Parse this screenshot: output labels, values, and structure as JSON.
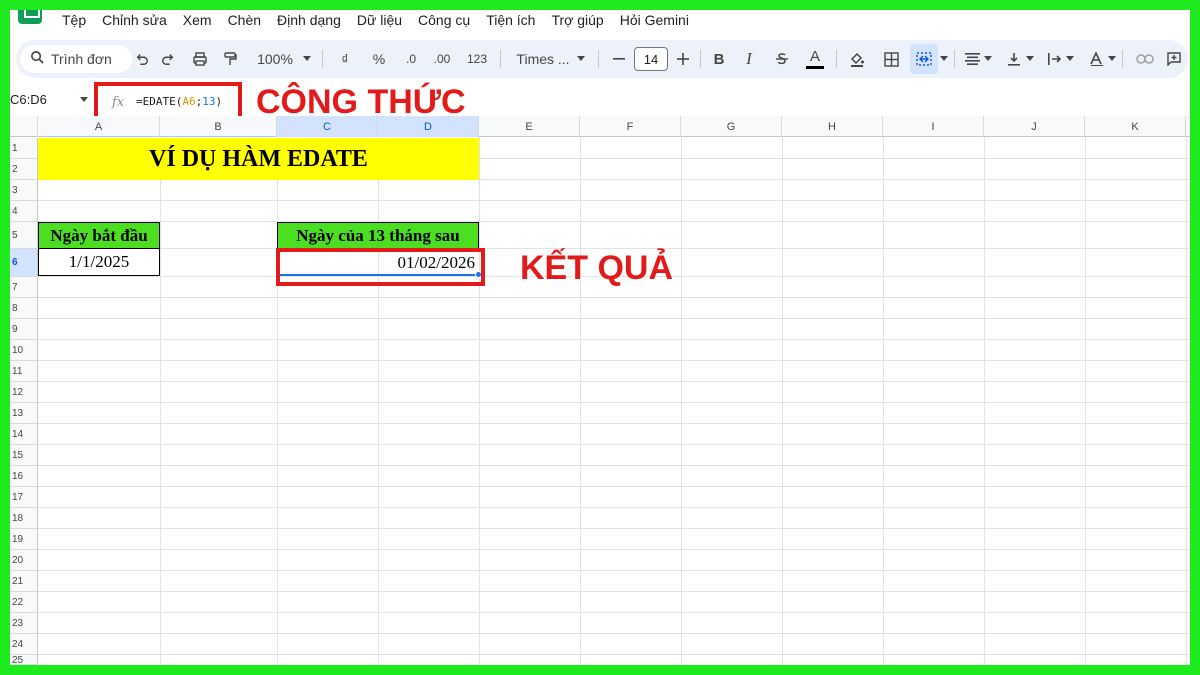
{
  "menu": {
    "items": [
      "Tệp",
      "Chỉnh sửa",
      "Xem",
      "Chèn",
      "Định dạng",
      "Dữ liệu",
      "Công cụ",
      "Tiện ích",
      "Trợ giúp",
      "Hỏi Gemini"
    ]
  },
  "toolbar": {
    "search_label": "Trình đơn",
    "zoom": "100%",
    "currency": "₫",
    "percent": "%",
    "decimal_decrease": ".0",
    "decimal_increase": ".00",
    "number_format": "123",
    "font_name": "Times ...",
    "font_size": "14",
    "bold": "B",
    "italic": "I",
    "text_color": "A"
  },
  "formula_bar": {
    "name_box": "C6:D6",
    "fx": "fx",
    "formula_prefix": "=EDATE(",
    "formula_ref": "A6",
    "formula_sep": ";",
    "formula_num": "13",
    "formula_suffix": ")"
  },
  "annotations": {
    "formula_label": "CÔNG THỨC",
    "result_label": "KẾT QUẢ"
  },
  "sheet": {
    "columns": [
      "A",
      "B",
      "C",
      "D",
      "E",
      "F",
      "G",
      "H",
      "I",
      "J",
      "K"
    ],
    "rows": [
      "1",
      "2",
      "3",
      "4",
      "5",
      "6",
      "7",
      "8",
      "9",
      "10",
      "11",
      "12",
      "13",
      "14",
      "15",
      "16",
      "17",
      "18",
      "19",
      "20",
      "21",
      "22",
      "23",
      "24",
      "25"
    ],
    "title": "VÍ DỤ HÀM EDATE",
    "start_header": "Ngày bắt đầu",
    "start_value": "1/1/2025",
    "result_header": "Ngày của 13 tháng sau",
    "result_value": "01/02/2026"
  },
  "colors": {
    "frame": "#1eeb1e",
    "title_fill": "#ffff00",
    "header_fill": "#4bde21",
    "annotation": "#e21a1a",
    "selection": "#1a73e8"
  }
}
